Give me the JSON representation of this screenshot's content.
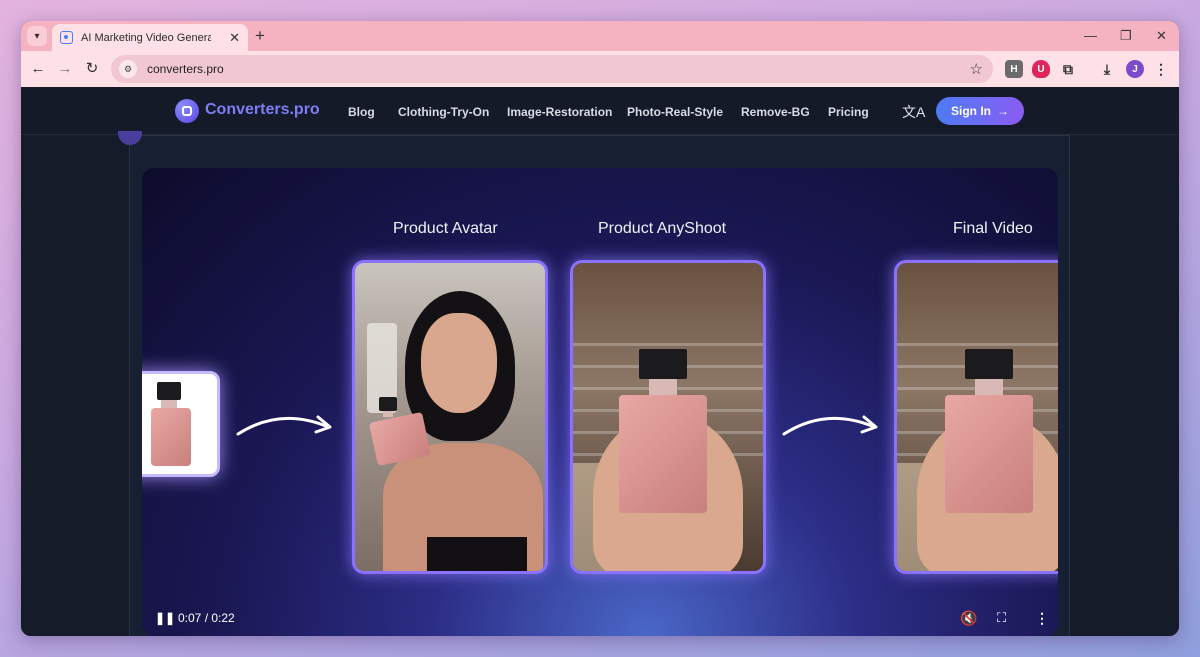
{
  "browser": {
    "tab_title": "AI Marketing Video Generator |",
    "url": "converters.pro",
    "profile_initial": "J",
    "ext_h_label": "H"
  },
  "site": {
    "logo_text": "Converters.pro",
    "nav": [
      "Blog",
      "Clothing-Try-On",
      "Image-Restoration",
      "Photo-Real-Style",
      "Remove-BG",
      "Pricing"
    ],
    "signin_label": "Sign In",
    "signin_arrow": "→"
  },
  "video": {
    "stages": [
      "Product Avatar",
      "Product AnyShoot",
      "Final Video"
    ],
    "time": "0:07 / 0:22"
  },
  "colors": {
    "accent": "#6b5cf5",
    "signin_start": "#4d7bf3",
    "signin_end": "#8a5cf2"
  }
}
